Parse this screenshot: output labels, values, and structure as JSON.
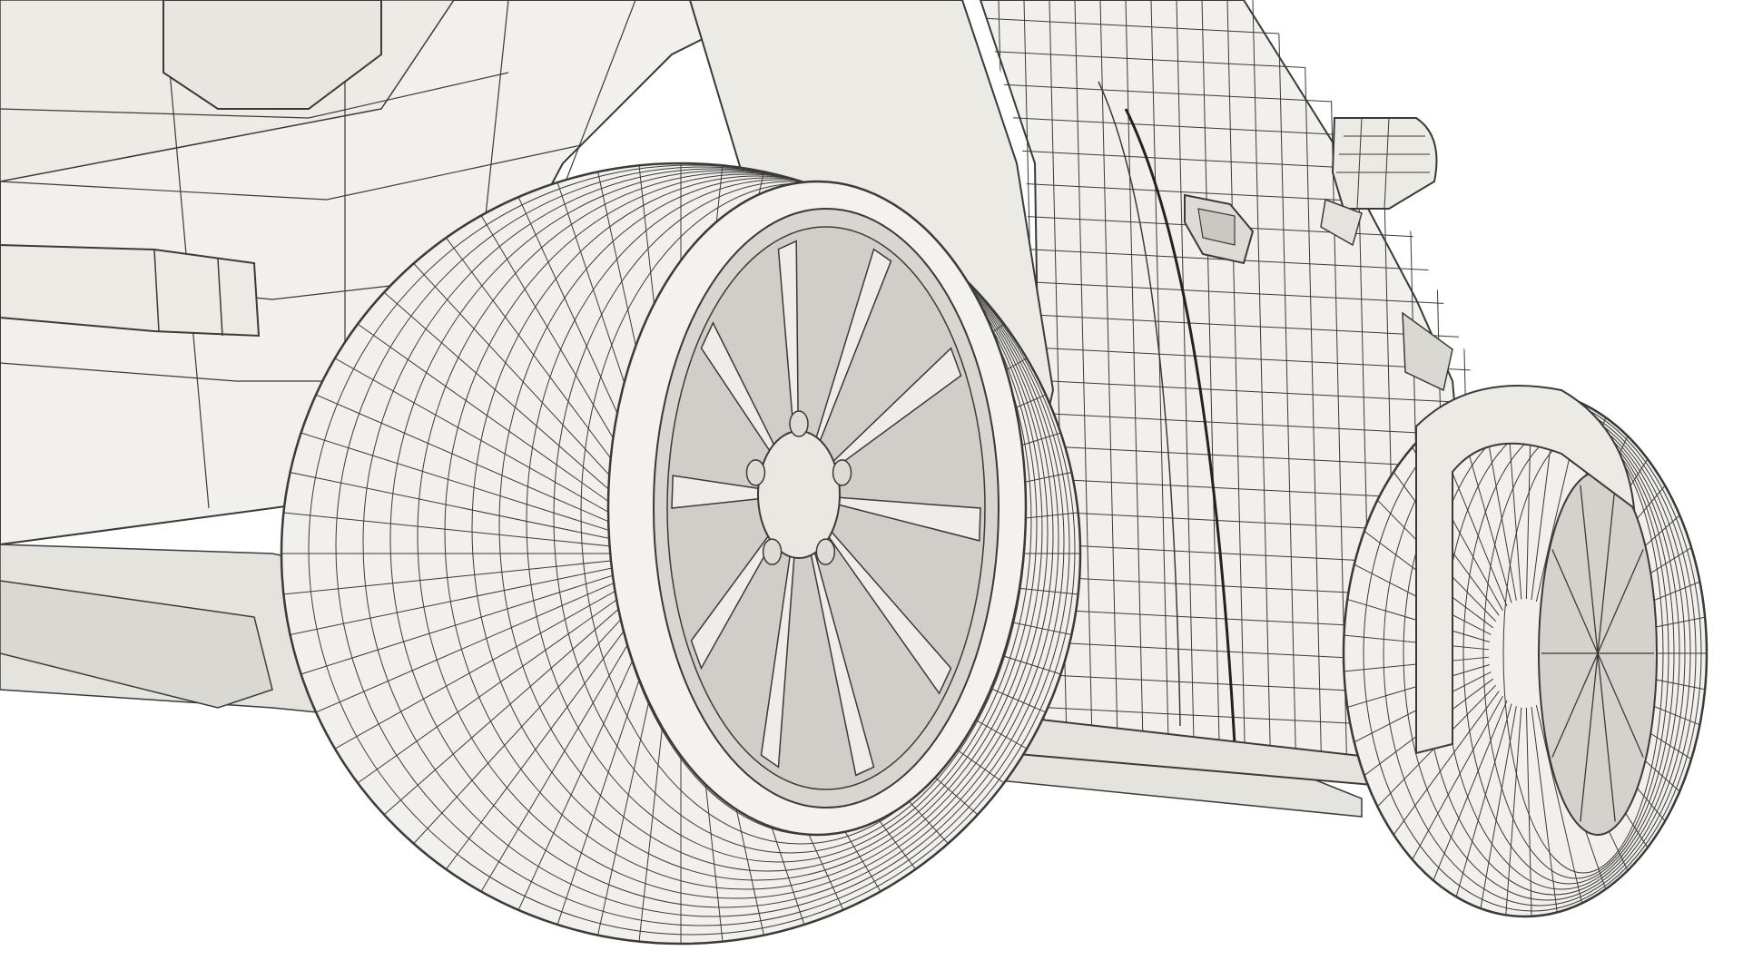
{
  "scene": {
    "description_visible_text": [],
    "colors": {
      "background": "#ffffff",
      "surface": "#f1f0ec",
      "surface_shade": "#e4e3de",
      "surface_dark": "#d3d2cc",
      "wire": "#3a3a3a"
    },
    "objects": [
      {
        "name": "car-body-front-fender",
        "icon": "car-body"
      },
      {
        "name": "front-tire",
        "icon": "tire"
      },
      {
        "name": "front-wheel-rim",
        "icon": "wheel-rim"
      },
      {
        "name": "side-mirror",
        "icon": "mirror"
      },
      {
        "name": "door-handle",
        "icon": "handle"
      },
      {
        "name": "rear-tire",
        "icon": "tire"
      },
      {
        "name": "side-skirt",
        "icon": "skirt"
      }
    ]
  }
}
